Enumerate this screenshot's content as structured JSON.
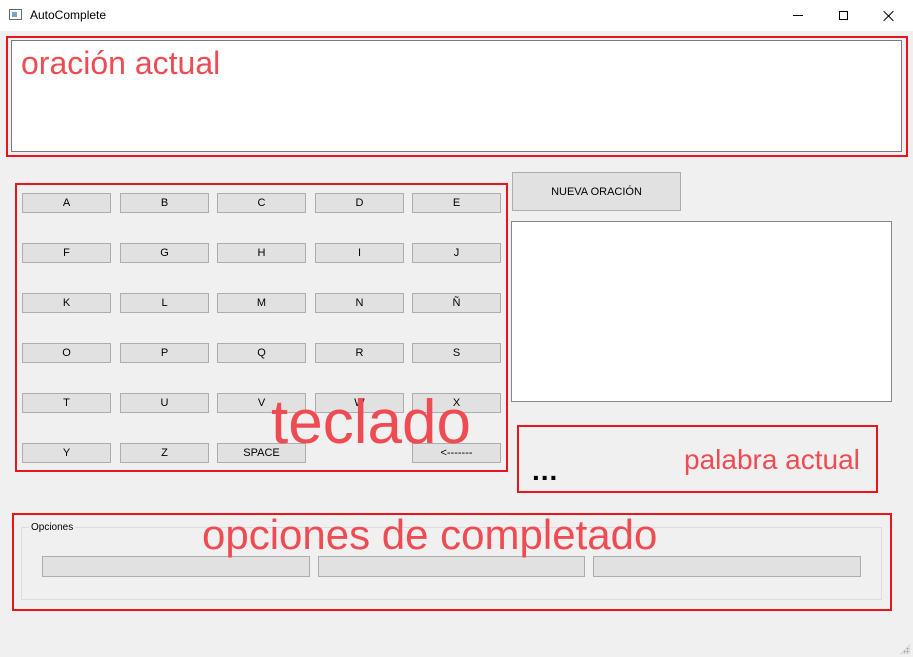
{
  "window": {
    "title": "AutoComplete",
    "icon": "app-window-icon",
    "controls": {
      "minimize": "minimize-icon",
      "maximize": "maximize-icon",
      "close": "close-icon"
    }
  },
  "annotations": {
    "sentence": "oración actual",
    "keyboard": "teclado",
    "current_word": "palabra actual",
    "options": "opciones de completado",
    "color": "#ee4b52",
    "box_color": "#e8161c"
  },
  "sentence": {
    "value": ""
  },
  "keyboard": {
    "rows": [
      [
        "A",
        "B",
        "C",
        "D",
        "E"
      ],
      [
        "F",
        "G",
        "H",
        "I",
        "J"
      ],
      [
        "K",
        "L",
        "M",
        "N",
        "Ñ"
      ],
      [
        "O",
        "P",
        "Q",
        "R",
        "S"
      ],
      [
        "T",
        "U",
        "V",
        "W",
        "X"
      ],
      [
        "Y",
        "Z",
        "SPACE",
        "",
        "<-------"
      ]
    ]
  },
  "new_sentence_button": "NUEVA ORACIÓN",
  "current_word": "...",
  "options": {
    "group_title": "Opciones",
    "buttons": [
      "",
      "",
      ""
    ]
  }
}
